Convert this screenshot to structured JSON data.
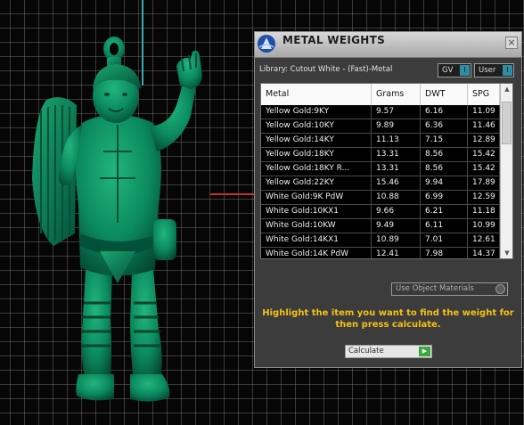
{
  "panel": {
    "title": "METAL WEIGHTS",
    "close_glyph": "×",
    "library": "Library: Cutout White - (Fast)-Metal",
    "toggles": [
      {
        "label": "GV",
        "state_glyph": "I"
      },
      {
        "label": "User",
        "state_glyph": "I"
      }
    ],
    "table": {
      "headers": {
        "metal": "Metal",
        "grams": "Grams",
        "dwt": "DWT",
        "spg": "SPG"
      },
      "rows": [
        {
          "metal": "Yellow Gold:9KY",
          "grams": "9.57",
          "dwt": "6.16",
          "spg": "11.09"
        },
        {
          "metal": "Yellow Gold:10KY",
          "grams": "9.89",
          "dwt": "6.36",
          "spg": "11.46"
        },
        {
          "metal": "Yellow Gold:14KY",
          "grams": "11.13",
          "dwt": "7.15",
          "spg": "12.89"
        },
        {
          "metal": "Yellow Gold:18KY",
          "grams": "13.31",
          "dwt": "8.56",
          "spg": "15.42"
        },
        {
          "metal": "Yellow Gold:18KY R...",
          "grams": "13.31",
          "dwt": "8.56",
          "spg": "15.42"
        },
        {
          "metal": "Yellow Gold:22KY",
          "grams": "15.46",
          "dwt": "9.94",
          "spg": "17.89"
        },
        {
          "metal": "White Gold:9K PdW",
          "grams": "10.88",
          "dwt": "6.99",
          "spg": "12.59"
        },
        {
          "metal": "White Gold:10KX1",
          "grams": "9.66",
          "dwt": "6.21",
          "spg": "11.18"
        },
        {
          "metal": "White Gold:10KW",
          "grams": "9.49",
          "dwt": "6.11",
          "spg": "10.99"
        },
        {
          "metal": "White Gold:14KX1",
          "grams": "10.89",
          "dwt": "7.01",
          "spg": "12.61"
        },
        {
          "metal": "White Gold:14K PdW",
          "grams": "12.41",
          "dwt": "7.98",
          "spg": "14.37"
        }
      ]
    },
    "use_object_materials": "Use Object Materials",
    "instructions": "Highlight the item you want to find the weight for then press calculate.",
    "calculate_label": "Calculate",
    "calculate_glyph": "▶"
  },
  "icons": {
    "app_logo": "rhino-gold-logo-icon",
    "close": "close-icon",
    "figure": "harp-warrior-pendant-model"
  },
  "colors": {
    "model": "#0b8a60",
    "grid": "#7f7f7f",
    "instruction_text": "#f3c215",
    "toggle_accent": "#2f8ea2",
    "calculate_go": "#39a83a",
    "axis_y": "#3fa7b8",
    "axis_x": "#c4312c"
  }
}
